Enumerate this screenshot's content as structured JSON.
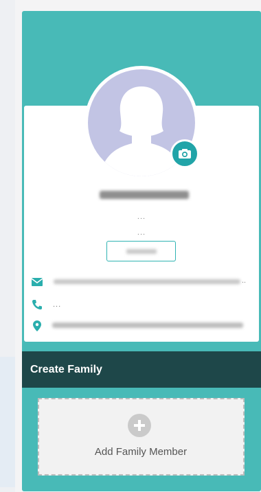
{
  "profile": {
    "detail_line_1": "...",
    "detail_line_2": "...",
    "avatar_color": "#c2c4e4",
    "accent_color": "#48bab7",
    "camera_button_color": "#21a4a8"
  },
  "contact": {
    "email_suffix": "..",
    "phone_text": "...",
    "email_icon": "envelope-icon",
    "phone_icon": "phone-icon",
    "address_icon": "map-pin-icon"
  },
  "family": {
    "section_title": "Create Family",
    "section_color": "#1e4749",
    "add_member_label": "Add Family Member",
    "add_icon": "plus-icon"
  }
}
